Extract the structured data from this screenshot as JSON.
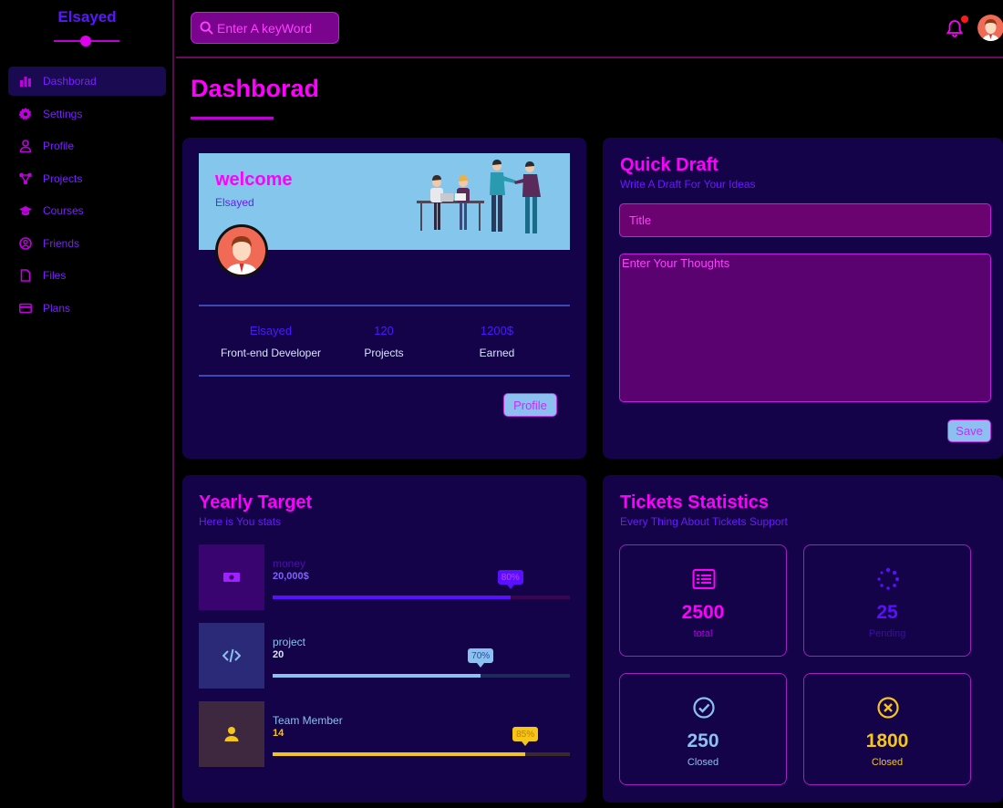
{
  "sidebar": {
    "brand": "Elsayed",
    "items": [
      {
        "label": "Dashborad",
        "icon": "chart-bar-icon",
        "active": true
      },
      {
        "label": "Settings",
        "icon": "gear-icon"
      },
      {
        "label": "Profile",
        "icon": "user-icon"
      },
      {
        "label": "Projects",
        "icon": "diagram-icon"
      },
      {
        "label": "Courses",
        "icon": "graduation-cap-icon"
      },
      {
        "label": "Friends",
        "icon": "user-circle-icon"
      },
      {
        "label": "Files",
        "icon": "file-icon"
      },
      {
        "label": "Plans",
        "icon": "credit-card-icon"
      }
    ]
  },
  "header": {
    "search_placeholder": "Enter A keyWord",
    "has_notification": true
  },
  "page_title": "Dashborad",
  "welcome": {
    "title": "welcome",
    "name": "Elsayed",
    "stats": [
      {
        "value": "Elsayed",
        "label": "Front-end Developer"
      },
      {
        "value": "120",
        "label": "Projects"
      },
      {
        "value": "1200$",
        "label": "Earned"
      }
    ],
    "button": "Profile"
  },
  "draft": {
    "title": "Quick Draft",
    "subtitle": "Write A Draft For Your Ideas",
    "title_placeholder": "Title",
    "body_placeholder": "Enter Your Thoughts",
    "button": "Save"
  },
  "target": {
    "title": "Yearly Target",
    "subtitle": "Here is You stats",
    "rows": [
      {
        "label": "money",
        "value": "20,000$",
        "percent": 80,
        "badge": "80%",
        "color": "#5a10ff",
        "icon": "money-icon"
      },
      {
        "label": "project",
        "value": "20",
        "percent": 70,
        "badge": "70%",
        "color": "#8cc0f0",
        "icon": "code-icon"
      },
      {
        "label": "Team Member",
        "value": "14",
        "percent": 85,
        "badge": "85%",
        "color": "#f5c518",
        "icon": "user-icon"
      }
    ]
  },
  "tickets": {
    "title": "Tickets Statistics",
    "subtitle": "Every Thing About Tickets Support",
    "boxes": [
      {
        "value": "2500",
        "label": "total",
        "icon": "list-icon",
        "color": "#ff00ff"
      },
      {
        "value": "25",
        "label": "Pending",
        "icon": "spinner-icon",
        "color": "#5a10ff"
      },
      {
        "value": "250",
        "label": "Closed",
        "icon": "check-circle-icon",
        "color": "#8cc0f0"
      },
      {
        "value": "1800",
        "label": "Closed",
        "icon": "x-circle-icon",
        "color": "#f5c518"
      }
    ]
  }
}
